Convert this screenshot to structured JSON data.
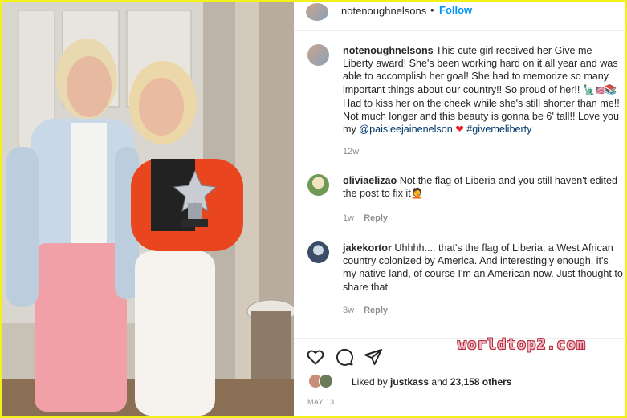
{
  "header": {
    "username": "notenoughnelsons",
    "separator": "•",
    "follow_label": "Follow"
  },
  "caption": {
    "username": "notenoughnelsons",
    "text_1": "This cute girl received her Give me Liberty award! She's been working hard on it all year and was able to accomplish her goal! She had to memorize so many important things about our country!! So proud of her!! ",
    "emoji_1": "🗽",
    "emoji_2": "🇱🇷",
    "emoji_3": "📚",
    "text_2": "Had to kiss her on the cheek while she's still shorter than me!! Not much longer and this beauty is gonna be 6' tall!! Love you my ",
    "mention": "@paisleejainenelson",
    "heart": "❤",
    "hashtag": "#givemeliberty",
    "time": "12w"
  },
  "comments": [
    {
      "username": "oliviaelizao",
      "text": "Not the flag of Liberia and you still haven't edited the post to fix it",
      "emoji": "🤦",
      "time": "1w",
      "reply_label": "Reply"
    },
    {
      "username": "jakekortor",
      "text": "Uhhhh.... that's the flag of Liberia, a West African country colonized by America. And interestingly enough, it's my native land, of course I'm an American now. Just thought to share that",
      "time": "3w",
      "reply_label": "Reply"
    }
  ],
  "actions": {
    "like_icon": "heart-outline-icon",
    "comment_icon": "comment-bubble-icon",
    "share_icon": "paper-plane-icon"
  },
  "likes": {
    "prefix": "Liked by ",
    "user": "justkass",
    "middle": " and ",
    "count": "23,158 others"
  },
  "date": "MAY 13",
  "watermark": "worldtop2.com",
  "colors": {
    "follow": "#0095f6",
    "border": "#f2f21a",
    "secondary_text": "#8e8e8e",
    "link": "#00376b"
  }
}
